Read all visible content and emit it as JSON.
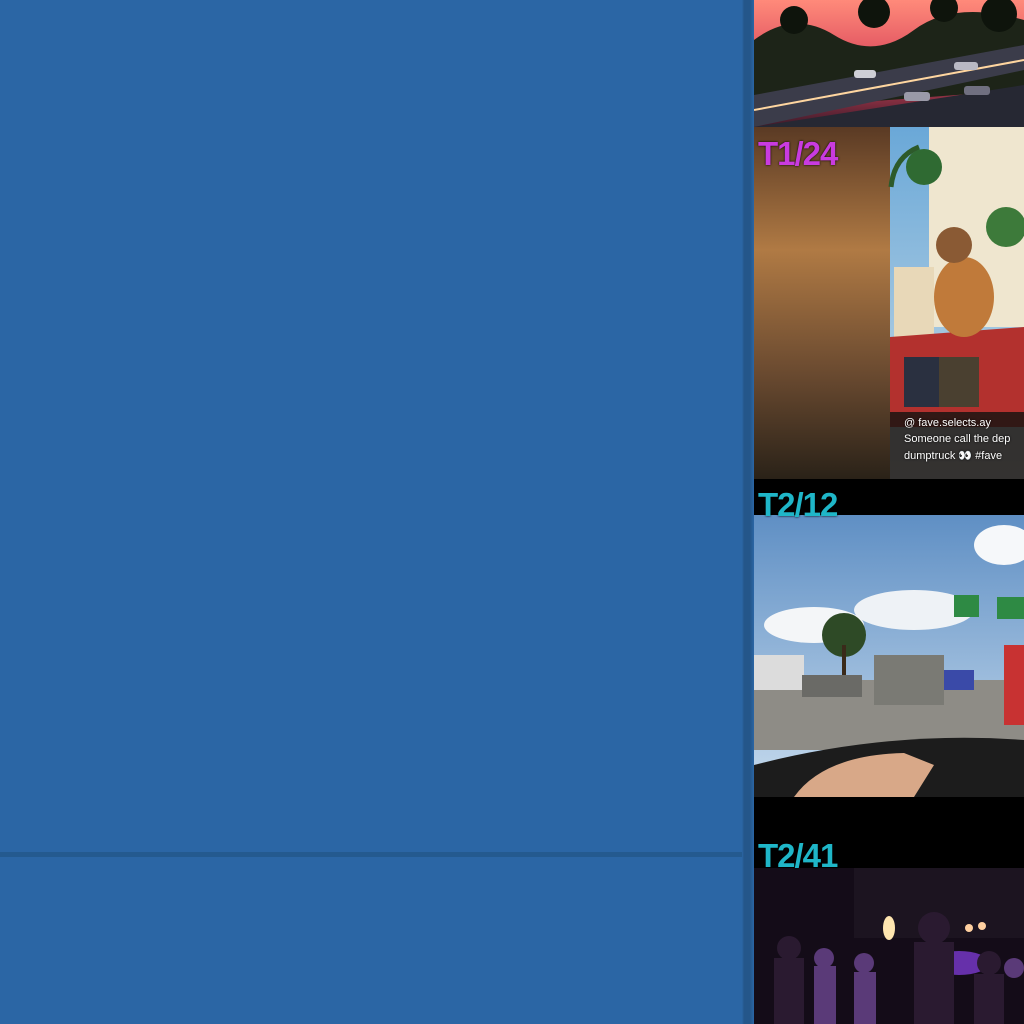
{
  "layout": {
    "background_color": "#2b66a5",
    "divider_color": "#245a8f"
  },
  "frames": [
    {
      "id": "frame-0",
      "label": "",
      "scene": "sunset highway with palm trees and cars",
      "accent": "#ff5a6a"
    },
    {
      "id": "frame-1",
      "label": "T1/24",
      "label_color": "#c93be0",
      "scene": "social media video: person on car roof, blurred side panel",
      "caption_user": "@ fave.selects.ay",
      "caption_text_1": "Someone call the dep",
      "caption_text_2": "dumptruck 👀 #fave"
    },
    {
      "id": "frame-2",
      "label": "T2/12",
      "label_color": "#1fb6c8",
      "scene": "first-person driving view on sunny road with trucks and highway signs"
    },
    {
      "id": "frame-3",
      "label": "T2/41",
      "label_color": "#1fb6c8",
      "scene": "night club crowd with purple lights"
    }
  ]
}
